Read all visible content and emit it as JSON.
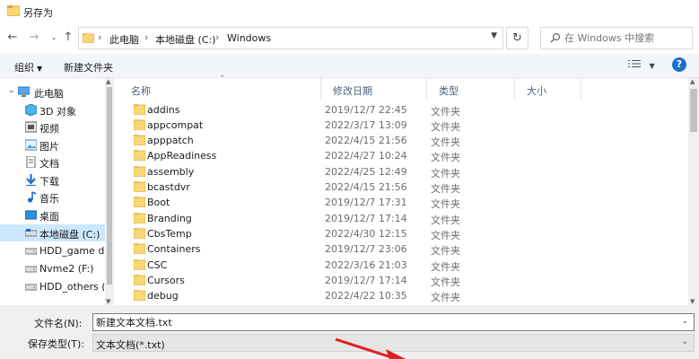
{
  "window": {
    "title": "另存为"
  },
  "address": {
    "crumbs": [
      "此电脑",
      "本地磁盘 (C:)",
      "Windows"
    ],
    "search_placeholder": "在 Windows 中搜索"
  },
  "toolbar": {
    "organize": "组织",
    "new_folder": "新建文件夹"
  },
  "nav": {
    "items": [
      {
        "label": "此电脑",
        "icon": "computer-icon"
      },
      {
        "label": "3D 对象",
        "icon": "3d-objects-icon"
      },
      {
        "label": "视频",
        "icon": "video-icon"
      },
      {
        "label": "图片",
        "icon": "pictures-icon"
      },
      {
        "label": "文档",
        "icon": "documents-icon"
      },
      {
        "label": "下载",
        "icon": "download-icon"
      },
      {
        "label": "音乐",
        "icon": "music-icon"
      },
      {
        "label": "桌面",
        "icon": "desktop-icon"
      },
      {
        "label": "本地磁盘 (C:)",
        "icon": "drive-icon",
        "selected": true
      },
      {
        "label": "HDD_game dis",
        "icon": "drive-icon"
      },
      {
        "label": "Nvme2 (F:)",
        "icon": "drive-icon"
      },
      {
        "label": "HDD_others (G",
        "icon": "drive-icon"
      }
    ]
  },
  "columns": {
    "name": "名称",
    "date": "修改日期",
    "type": "类型",
    "size": "大小"
  },
  "files": [
    {
      "name": "addins",
      "date": "2019/12/7 22:45",
      "type": "文件夹"
    },
    {
      "name": "appcompat",
      "date": "2022/3/17 13:09",
      "type": "文件夹"
    },
    {
      "name": "apppatch",
      "date": "2022/4/15 21:56",
      "type": "文件夹"
    },
    {
      "name": "AppReadiness",
      "date": "2022/4/27 10:24",
      "type": "文件夹"
    },
    {
      "name": "assembly",
      "date": "2022/4/25 12:49",
      "type": "文件夹"
    },
    {
      "name": "bcastdvr",
      "date": "2022/4/15 21:56",
      "type": "文件夹"
    },
    {
      "name": "Boot",
      "date": "2019/12/7 17:31",
      "type": "文件夹"
    },
    {
      "name": "Branding",
      "date": "2019/12/7 17:14",
      "type": "文件夹"
    },
    {
      "name": "CbsTemp",
      "date": "2022/4/30 12:15",
      "type": "文件夹"
    },
    {
      "name": "Containers",
      "date": "2019/12/7 23:06",
      "type": "文件夹"
    },
    {
      "name": "CSC",
      "date": "2022/3/16 21:03",
      "type": "文件夹"
    },
    {
      "name": "Cursors",
      "date": "2019/12/7 17:14",
      "type": "文件夹"
    },
    {
      "name": "debug",
      "date": "2022/4/22 10:35",
      "type": "文件夹"
    }
  ],
  "save": {
    "filename_label": "文件名(N):",
    "filename_value": "新建文本文档.txt",
    "filetype_label": "保存类型(T):",
    "filetype_value": "文本文档(*.txt)"
  },
  "colors": {
    "selected": "#cce8ff",
    "folder": "#f8d775",
    "accent": "#1c70c8",
    "annotation_arrow": "#e02020"
  }
}
